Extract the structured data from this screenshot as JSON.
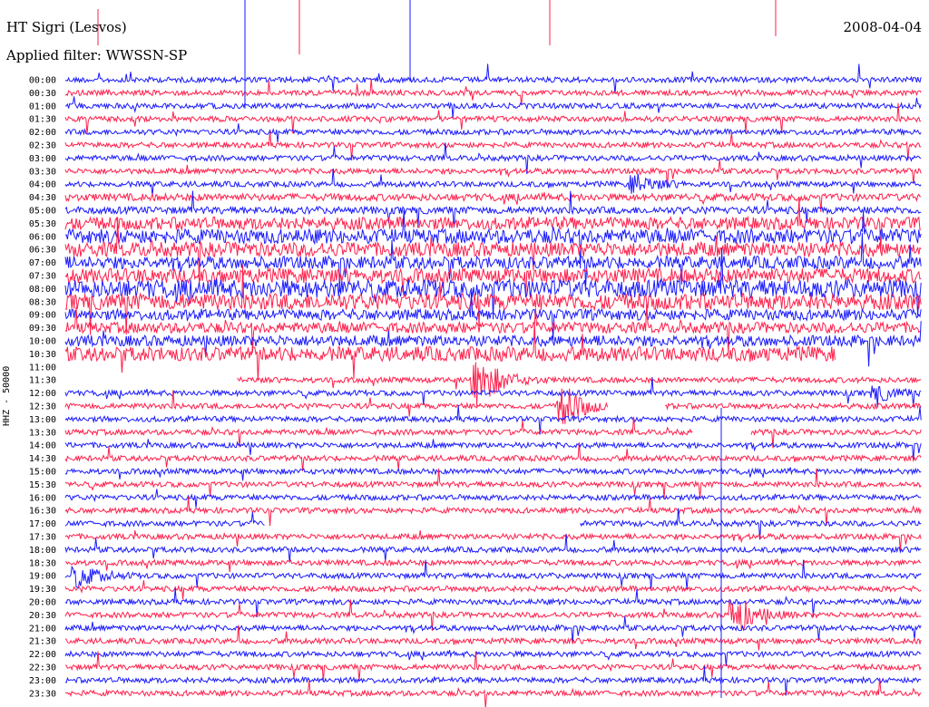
{
  "header": {
    "station": "HT Sigri (Lesvos)",
    "date": "2008-04-04",
    "filter": "Applied filter: WWSSN-SP"
  },
  "chart_data": {
    "type": "line",
    "ylabel": "HHZ - 50000",
    "xlabel": "",
    "row_labels": [
      "00:00",
      "00:30",
      "01:00",
      "01:30",
      "02:00",
      "02:30",
      "03:00",
      "03:30",
      "04:00",
      "04:30",
      "05:00",
      "05:30",
      "06:00",
      "06:30",
      "07:00",
      "07:30",
      "08:00",
      "08:30",
      "09:00",
      "09:30",
      "10:00",
      "10:30",
      "11:00",
      "11:30",
      "12:00",
      "12:30",
      "13:00",
      "13:30",
      "14:00",
      "14:30",
      "15:00",
      "15:30",
      "16:00",
      "16:30",
      "17:00",
      "17:30",
      "18:00",
      "18:30",
      "19:00",
      "19:30",
      "20:00",
      "20:30",
      "21:00",
      "21:30",
      "22:00",
      "22:30",
      "23:00",
      "23:30"
    ],
    "row_minutes": 30,
    "series_colors": [
      "#1a1aff",
      "#ff1f4b"
    ],
    "noise_level": [
      3,
      3,
      3,
      3,
      3,
      3,
      3,
      3,
      3,
      4,
      4,
      7,
      8,
      8,
      7,
      8,
      10,
      9,
      6,
      6,
      6,
      8,
      0,
      3,
      3,
      3,
      3,
      3,
      3,
      3,
      3,
      3,
      3,
      3,
      3,
      3,
      3,
      3,
      3,
      3,
      3,
      3,
      3,
      3,
      3,
      3,
      3,
      3
    ],
    "gaps": [
      {
        "row": 21,
        "from": 27,
        "to": 30
      },
      {
        "row": 22,
        "from": 0,
        "to": 30
      },
      {
        "row": 23,
        "from": 0,
        "to": 6
      },
      {
        "row": 25,
        "from": 19,
        "to": 21
      },
      {
        "row": 27,
        "from": 22,
        "to": 24
      },
      {
        "row": 34,
        "from": 7,
        "to": 18
      }
    ],
    "events": [
      {
        "row": 23,
        "minute": 14.5,
        "amplitude": 30
      },
      {
        "row": 25,
        "minute": 17.5,
        "amplitude": 22
      },
      {
        "row": 38,
        "minute": 0.5,
        "amplitude": 12
      },
      {
        "row": 41,
        "minute": 23.5,
        "amplitude": 22
      },
      {
        "row": 24,
        "minute": 28.5,
        "amplitude": 8
      },
      {
        "row": 8,
        "minute": 20,
        "amplitude": 10
      }
    ]
  }
}
